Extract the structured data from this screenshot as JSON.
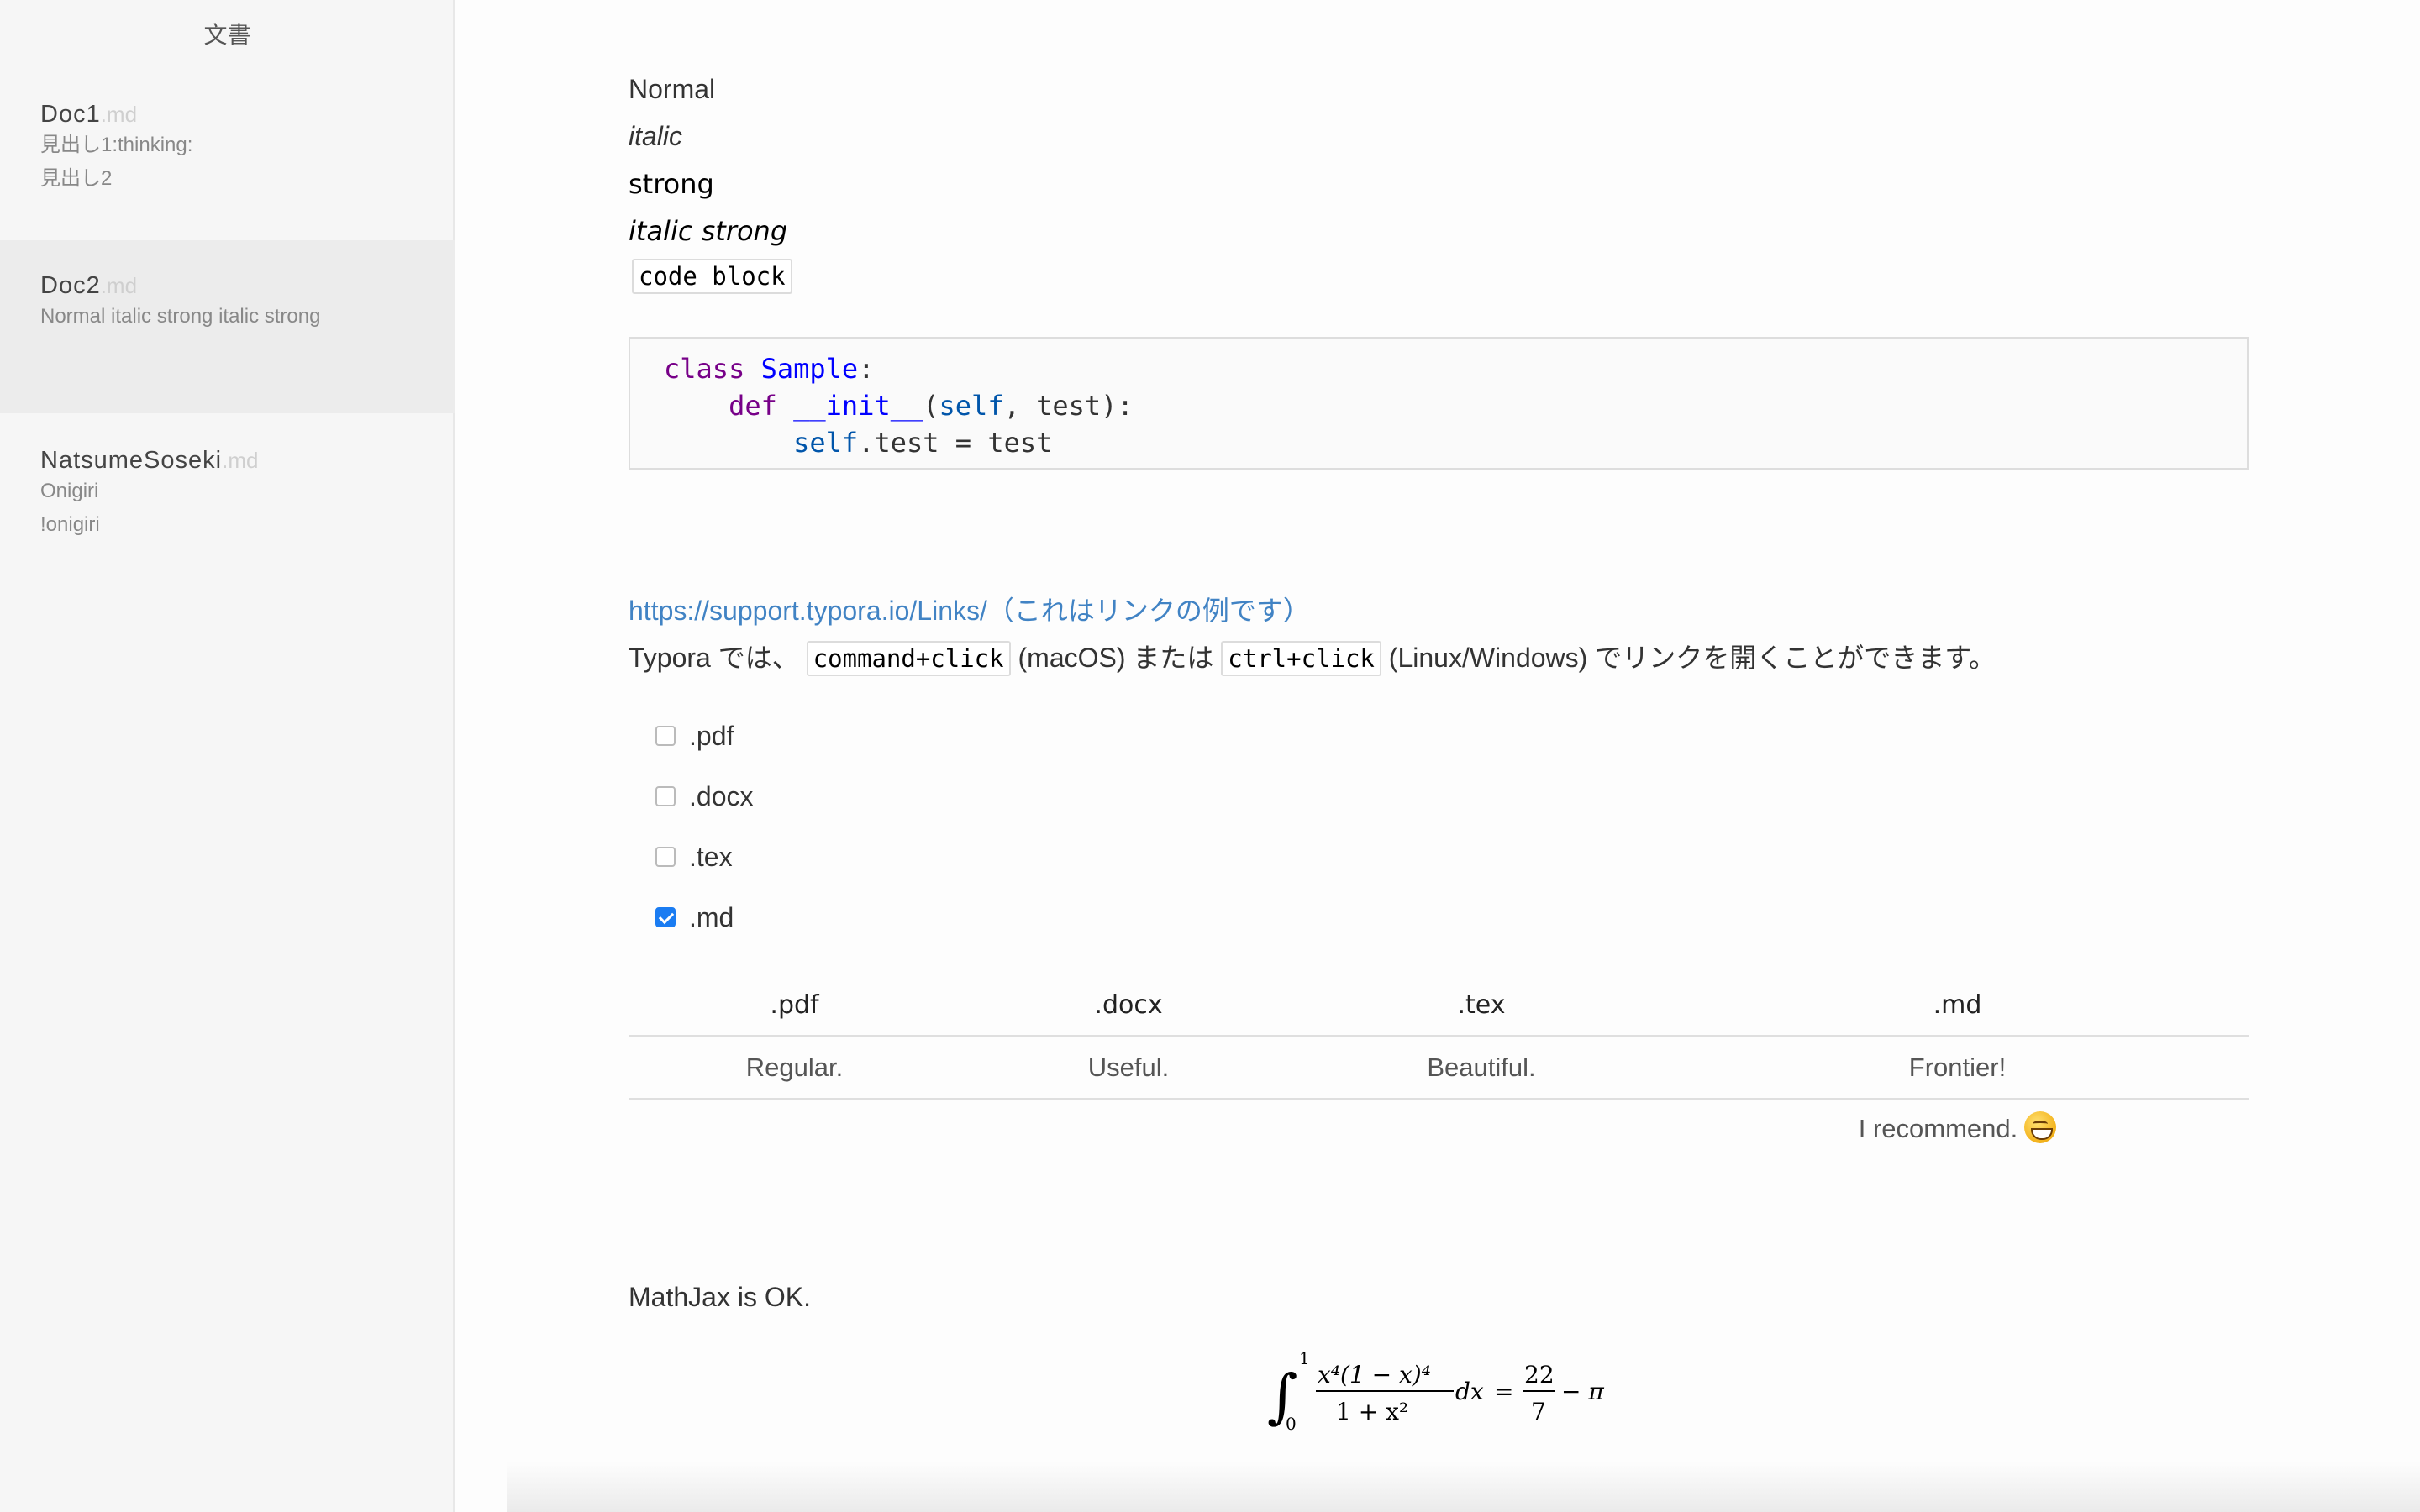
{
  "sidebar": {
    "title": "文書",
    "docs": [
      {
        "name": "Doc1",
        "ext": ".md",
        "lines": [
          "見出し1:thinking:",
          "見出し2"
        ]
      },
      {
        "name": "Doc2",
        "ext": ".md",
        "lines": [
          "Normal italic strong italic strong"
        ]
      },
      {
        "name": "NatsumeSoseki",
        "ext": ".md",
        "lines": [
          "Onigiri",
          "!onigiri"
        ]
      }
    ]
  },
  "editor": {
    "normal": "Normal",
    "italic": "italic",
    "strong": "strong",
    "italic_strong": "italic strong",
    "code_inline": "code block",
    "code": {
      "line1_kw": "class",
      "line1_name": "Sample",
      "line1_rest": ":",
      "line2_kw": "def",
      "line2_name": "__init__",
      "line2_p1": "(",
      "line2_self": "self",
      "line2_p2": ", test):",
      "line3_self": "self",
      "line3_rest": ".test = test"
    },
    "link_text": "https://support.typora.io/Links/（これはリンクの例です）",
    "link_desc": {
      "before": "Typora では、",
      "code1": "command+click",
      "mid": " (macOS) または ",
      "code2": "ctrl+click",
      "after": " (Linux/Windows) でリンクを開くことができます。"
    },
    "tasks": [
      {
        "label": ".pdf",
        "checked": false
      },
      {
        "label": ".docx",
        "checked": false
      },
      {
        "label": ".tex",
        "checked": false
      },
      {
        "label": ".md",
        "checked": true
      }
    ],
    "table": {
      "headers": [
        ".pdf",
        ".docx",
        ".tex",
        ".md"
      ],
      "rows": [
        [
          "Regular.",
          "Useful.",
          "Beautiful.",
          "Frontier!"
        ],
        [
          "",
          "",
          "",
          "I recommend."
        ]
      ]
    },
    "emoji": "smile-emoji",
    "math_intro": "MathJax is OK.",
    "math": {
      "integral_upper": "1",
      "integral_lower": "0",
      "numerator": "x⁴(1 − x)⁴",
      "denominator": "1 + x²",
      "dx": "dx",
      "equals": "=",
      "frac_num": "22",
      "frac_den": "7",
      "tail": "− π"
    }
  }
}
